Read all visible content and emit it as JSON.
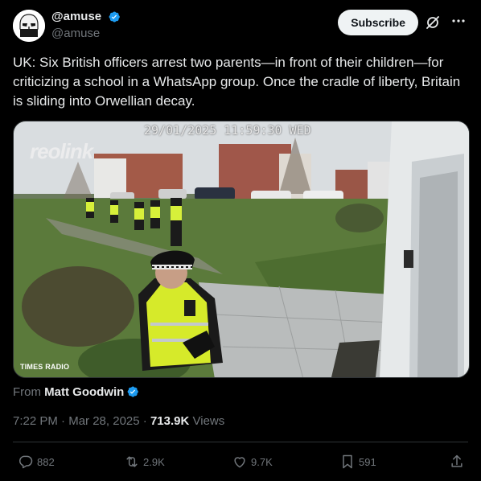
{
  "author": {
    "display_name": "@amuse",
    "handle": "@amuse"
  },
  "header": {
    "subscribe_label": "Subscribe",
    "grok_icon": "grok-icon",
    "more_icon": "more-icon"
  },
  "tweet": {
    "text": "UK: Six British officers arrest two parents—in front of their children—for criticizing a school in a WhatsApp group. Once the cradle of liberty, Britain is sliding into Orwellian decay."
  },
  "media": {
    "overlay_timestamp": "29/01/2025 11:59:30 WED",
    "watermark": "reolink",
    "source_tag": "TIMES RADIO"
  },
  "from": {
    "prefix": "From",
    "name": "Matt Goodwin"
  },
  "meta": {
    "time": "7:22 PM",
    "date": "Mar 28, 2025",
    "views_count": "713.9K",
    "views_label": "Views"
  },
  "actions": {
    "replies": "882",
    "reposts": "2.9K",
    "likes": "9.7K",
    "bookmarks": "591"
  },
  "colors": {
    "background": "#000000",
    "text": "#e7e9ea",
    "muted": "#71767b",
    "verified": "#1d9bf0",
    "divider": "#2f3336"
  }
}
